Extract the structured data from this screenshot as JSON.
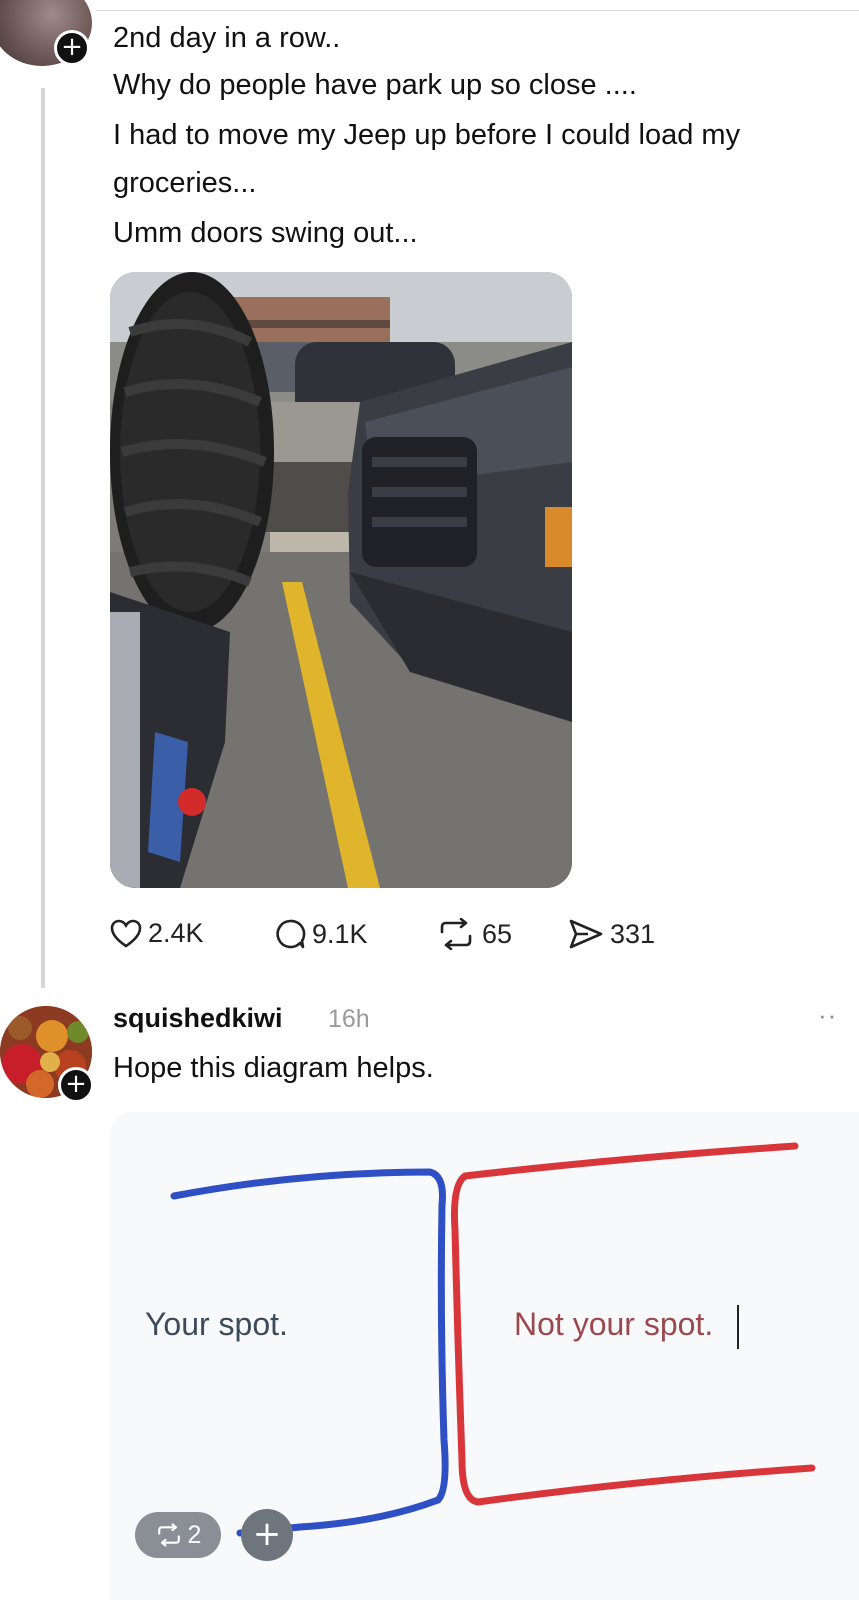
{
  "post": {
    "lines": [
      "2nd day in a row..",
      "Why do people have park up so close ....",
      "I had to move my Jeep up before I could load my",
      "groceries...",
      "Umm doors swing out..."
    ],
    "stats": {
      "likes": "2.4K",
      "comments": "9.1K",
      "reposts": "65",
      "shares": "331"
    }
  },
  "reply": {
    "username": "squishedkiwi",
    "time": "16h",
    "more": "··",
    "text": "Hope this diagram helps.",
    "diagram": {
      "left_label": "Your spot.",
      "right_label": "Not your spot.",
      "left_color": "#2f4fc4",
      "right_color": "#d9363b"
    },
    "repost_count": "2"
  },
  "icons": {
    "follow_badge": "plus-icon",
    "like": "heart-icon",
    "comment": "comment-bubble-icon",
    "repost": "repost-icon",
    "share": "send-icon"
  }
}
